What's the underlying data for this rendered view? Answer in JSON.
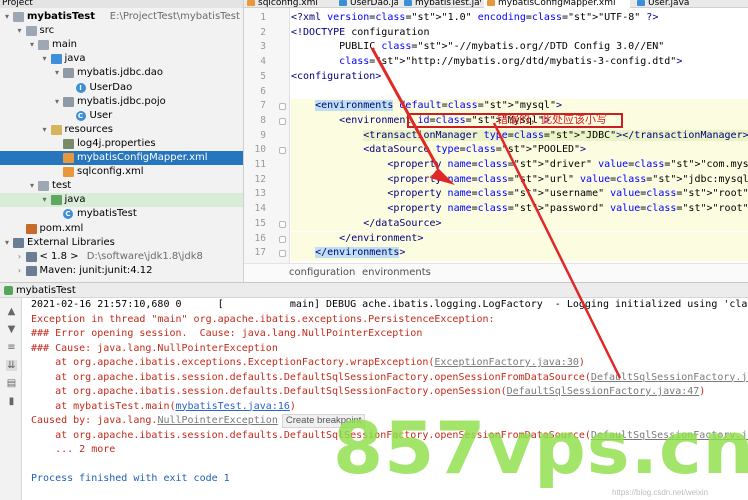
{
  "project": {
    "header": "Project",
    "tree": [
      {
        "label": "mybatisTest",
        "path": "E:\\ProjectTest\\mybatisTest",
        "indent": 0,
        "icon": "module-folder-icon",
        "arrow": "▾"
      },
      {
        "label": "src",
        "indent": 1,
        "icon": "folder-icon",
        "arrow": "▾"
      },
      {
        "label": "main",
        "indent": 2,
        "icon": "folder-icon",
        "arrow": "▾"
      },
      {
        "label": "java",
        "indent": 3,
        "icon": "source-folder-icon",
        "arrow": "▾"
      },
      {
        "label": "mybatis.jdbc.dao",
        "indent": 4,
        "icon": "package-icon",
        "arrow": "▾"
      },
      {
        "label": "UserDao",
        "indent": 5,
        "icon": "interface-icon",
        "arrow": ""
      },
      {
        "label": "mybatis.jdbc.pojo",
        "indent": 4,
        "icon": "package-icon",
        "arrow": "▾"
      },
      {
        "label": "User",
        "indent": 5,
        "icon": "class-icon",
        "arrow": ""
      },
      {
        "label": "resources",
        "indent": 3,
        "icon": "resources-folder-icon",
        "arrow": "▾"
      },
      {
        "label": "log4j.properties",
        "indent": 4,
        "icon": "properties-file-icon",
        "arrow": ""
      },
      {
        "label": "mybatisConfigMapper.xml",
        "indent": 4,
        "icon": "xml-file-icon",
        "arrow": "",
        "selected": true
      },
      {
        "label": "sqlconfig.xml",
        "indent": 4,
        "icon": "xml-file-icon",
        "arrow": ""
      },
      {
        "label": "test",
        "indent": 2,
        "icon": "folder-icon",
        "arrow": "▾"
      },
      {
        "label": "java",
        "indent": 3,
        "icon": "test-folder-icon",
        "arrow": "▾",
        "highlighted": true
      },
      {
        "label": "mybatisTest",
        "indent": 4,
        "icon": "class-icon",
        "arrow": ""
      },
      {
        "label": "pom.xml",
        "indent": 1,
        "icon": "maven-file-icon",
        "arrow": ""
      },
      {
        "label": "External Libraries",
        "indent": 0,
        "icon": "library-icon",
        "arrow": "▾"
      },
      {
        "label": "< 1.8 >",
        "path": "D:\\software\\jdk1.8\\jdk8",
        "indent": 1,
        "icon": "jdk-icon",
        "arrow": "›"
      },
      {
        "label": "Maven: junit:junit:4.12",
        "indent": 1,
        "icon": "library-icon",
        "arrow": "›"
      }
    ]
  },
  "tabs": [
    {
      "label": "sqlconfig.xml"
    },
    {
      "label": "UserDao.java"
    },
    {
      "label": "mybatisTest.java"
    },
    {
      "label": "mybatisConfigMapper.xml",
      "active": true
    },
    {
      "label": "User.java"
    }
  ],
  "editor": {
    "line_numbers": [
      "1",
      "2",
      "3",
      "4",
      "5",
      "6",
      "7",
      "8",
      "9",
      "10",
      "11",
      "12",
      "13",
      "14",
      "15",
      "16",
      "17",
      "18"
    ],
    "lines": [
      "<?xml version=\"1.0\" encoding=\"UTF-8\" ?>",
      "<!DOCTYPE configuration",
      "        PUBLIC \"-//mybatis.org//DTD Config 3.0//EN\"",
      "        \"http://mybatis.org/dtd/mybatis-3-config.dtd\">",
      "<configuration>",
      "",
      "    <environments default=\"mysql\">",
      "        <environment id=\"Mysql\">",
      "            <transactionManager type=\"JDBC\"></transactionManager>",
      "            <dataSource type=\"POOLED\">",
      "                <property name=\"driver\" value=\"com.mysql.jdbc.Driver\"/>",
      "                <property name=\"url\" value=\"jdbc:mysql://localhost:3306/test\"/>",
      "                <property name=\"username\" value=\"root\"/>",
      "                <property name=\"password\" value=\"root\"/>",
      "            </dataSource>",
      "        </environment>",
      "    </environments>",
      ""
    ],
    "breadcrumb": [
      "configuration",
      "environments"
    ],
    "annotation": "错误的，此处应该小写"
  },
  "run": {
    "tab_label": "mybatisTest",
    "console": [
      {
        "t": "2021-02-16 21:57:10,680 0      [           main] DEBUG ache.ibatis.logging.LogFactory  - Logging initialized using 'class org.apache",
        "c": "blk"
      },
      {
        "t": "Exception in thread \"main\" org.apache.ibatis.exceptions.PersistenceException:",
        "c": "red"
      },
      {
        "t": "### Error opening session.  Cause: java.lang.NullPointerException",
        "c": "red"
      },
      {
        "t": "### Cause: java.lang.NullPointerException",
        "c": "red"
      },
      {
        "t": "    at org.apache.ibatis.exceptions.ExceptionFactory.wrapException(",
        "c": "red",
        "link": "ExceptionFactory.java:30",
        "link_style": "lnk-g",
        "tail": ")"
      },
      {
        "t": "    at org.apache.ibatis.session.defaults.DefaultSqlSessionFactory.openSessionFromDataSource(",
        "c": "red",
        "link": "DefaultSqlSessionFactory.java:100",
        "link_style": "lnk-g",
        "tail": ")"
      },
      {
        "t": "    at org.apache.ibatis.session.defaults.DefaultSqlSessionFactory.openSession(",
        "c": "red",
        "link": "DefaultSqlSessionFactory.java:47",
        "link_style": "lnk-g",
        "tail": ")"
      },
      {
        "t": "    at mybatisTest.main(",
        "c": "red",
        "link": "mybatisTest.java:16",
        "link_style": "lnk",
        "tail": ")"
      },
      {
        "t": "Caused by: java.lang.",
        "c": "red",
        "link": "NullPointerException",
        "link_style": "lnk-g",
        "tail": "",
        "bp": "Create breakpoint"
      },
      {
        "t": "    at org.apache.ibatis.session.defaults.DefaultSqlSessionFactory.openSessionFromDataSource(",
        "c": "red",
        "link": "DefaultSqlSessionFactory.java:95",
        "link_style": "lnk-g",
        "tail": ")"
      },
      {
        "t": "    ... 2 more",
        "c": "red"
      },
      {
        "t": "",
        "c": "blk"
      },
      {
        "t": "Process finished with exit code 1",
        "c": "blue"
      }
    ]
  },
  "watermark": {
    "main": "857vps.cn",
    "small": "https://blog.csdn.net/weixin"
  }
}
